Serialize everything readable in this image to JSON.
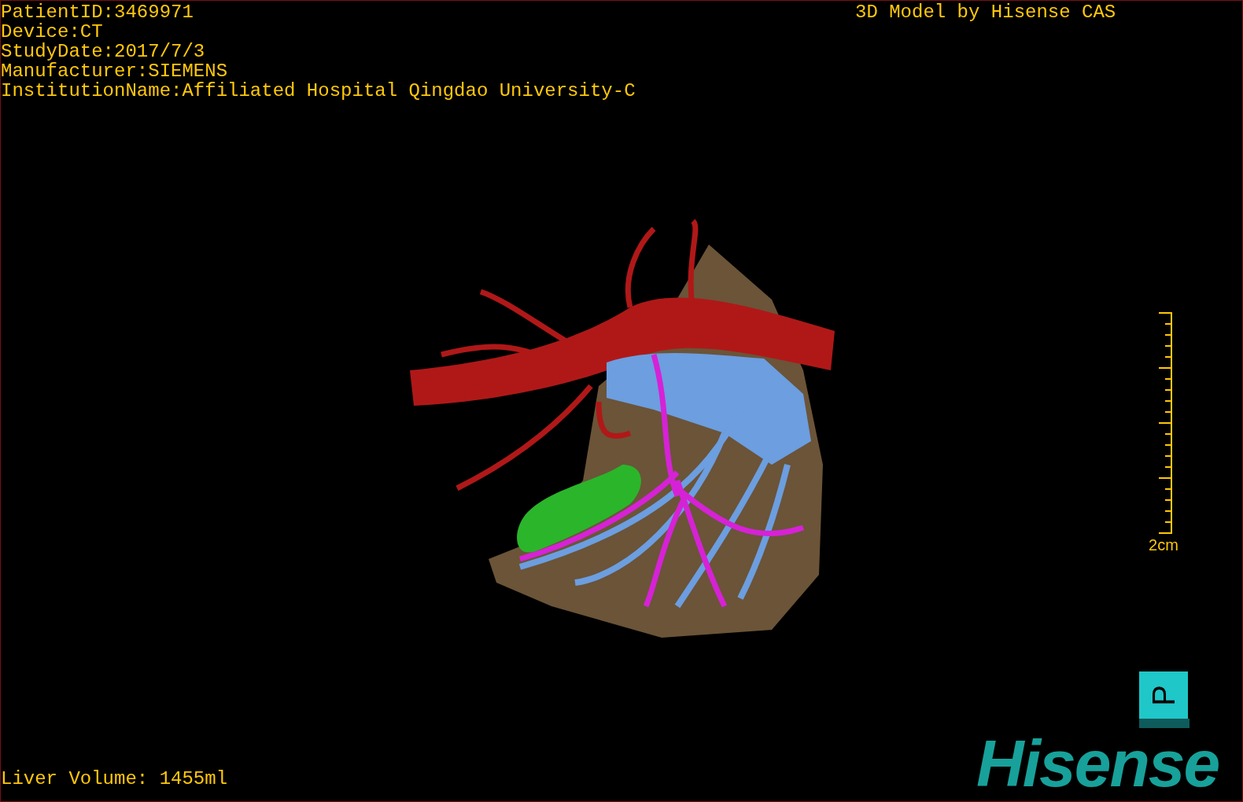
{
  "info_lines": [
    "PatientID:3469971",
    "Device:CT",
    "StudyDate:2017/7/3",
    "Manufacturer:SIEMENS",
    "InstitutionName:Affiliated Hospital Qingdao University-C"
  ],
  "credit": "3D Model by Hisense CAS",
  "scale_bar": {
    "label": "2cm"
  },
  "orientation_cube": {
    "face_label": "P"
  },
  "liver_volume": "Liver Volume: 1455ml",
  "logo": "Hisense"
}
